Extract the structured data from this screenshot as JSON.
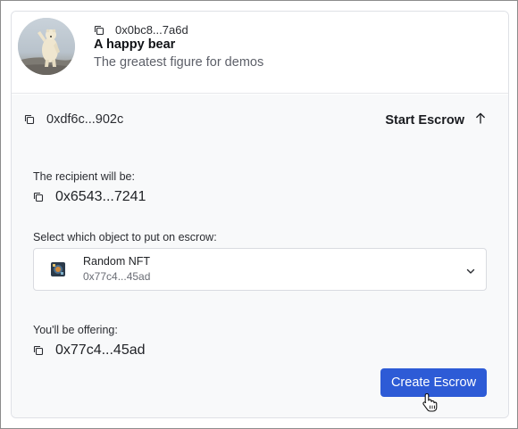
{
  "object": {
    "id_short": "0x0bc8...7a6d",
    "title": "A happy bear",
    "description": "The greatest figure for demos"
  },
  "owner": {
    "address_short": "0xdf6c...902c"
  },
  "actions": {
    "start_escrow_label": "Start Escrow"
  },
  "recipient": {
    "label": "The recipient will be:",
    "address_short": "0x6543...7241"
  },
  "select": {
    "label": "Select which object to put on escrow:",
    "selected": {
      "name": "Random NFT",
      "id_short": "0x77c4...45ad"
    }
  },
  "offering": {
    "label": "You'll be offering:",
    "address_short": "0x77c4...45ad"
  },
  "create_button_label": "Create Escrow",
  "colors": {
    "primary_button": "#2d5bd6",
    "card_border": "#dfe1e6",
    "body_bg": "#f8f9fa"
  },
  "icons": [
    "copy-icon",
    "arrow-up-icon",
    "chevron-down-icon",
    "hand-pointer-cursor"
  ]
}
